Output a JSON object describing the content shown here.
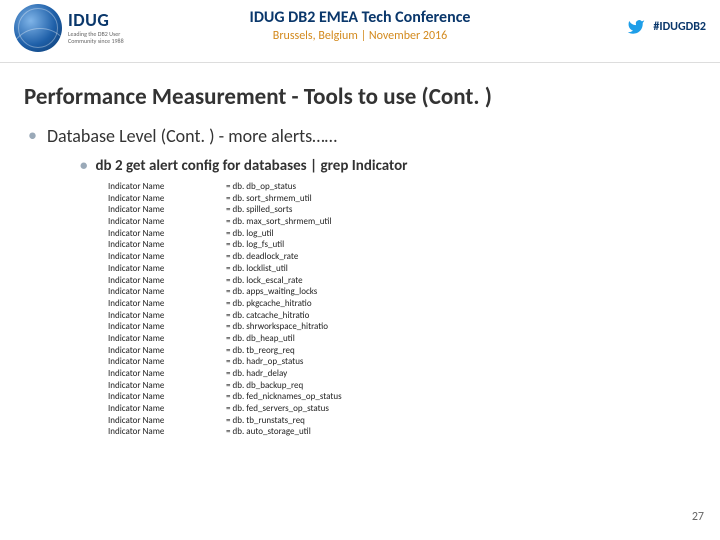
{
  "header": {
    "logo_main": "IDUG",
    "logo_sub": "Leading the DB2 User Community since 1988",
    "title": "IDUG DB2 EMEA Tech Conference",
    "subtitle": "Brussels, Belgium  |  November 2016",
    "hashtag": "#IDUGDB2"
  },
  "slide_title": "Performance Measurement  - Tools to use (Cont. )",
  "bullet1": "Database Level (Cont. ) - more alerts……",
  "bullet2": "db 2 get alert config for databases | grep Indicator",
  "label": "Indicator Name",
  "values": [
    "= db. db_op_status",
    "= db. sort_shrmem_util",
    "= db. spilled_sorts",
    "= db. max_sort_shrmem_util",
    "= db. log_util",
    "= db. log_fs_util",
    "= db. deadlock_rate",
    "= db. locklist_util",
    "= db. lock_escal_rate",
    "= db. apps_waiting_locks",
    "= db. pkgcache_hitratio",
    "= db. catcache_hitratio",
    "= db. shrworkspace_hitratio",
    "= db. db_heap_util",
    "= db. tb_reorg_req",
    "= db. hadr_op_status",
    "= db. hadr_delay",
    "= db. db_backup_req",
    "= db. fed_nicknames_op_status",
    "= db. fed_servers_op_status",
    "= db. tb_runstats_req",
    "= db. auto_storage_util"
  ],
  "pagenum": "27"
}
